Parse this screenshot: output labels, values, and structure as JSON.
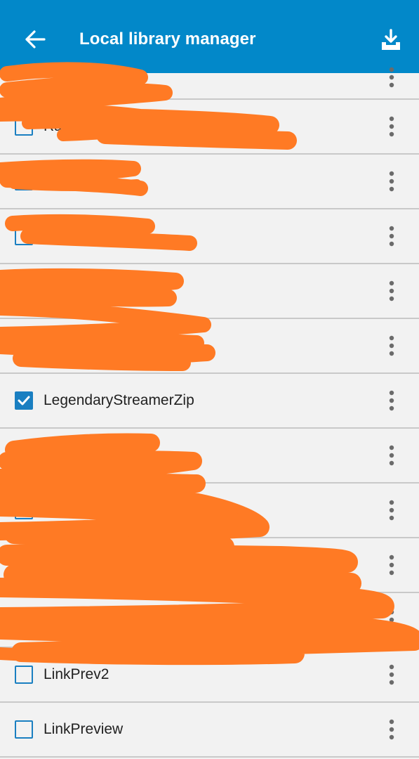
{
  "toolbar": {
    "title": "Local library manager",
    "back_icon": "arrow-back-icon",
    "download_icon": "download-tray-icon",
    "background_color": "#0288c9"
  },
  "list": {
    "items": [
      {
        "label": "",
        "checked": false,
        "redacted": true
      },
      {
        "label": "Ra",
        "checked": false,
        "redacted": true
      },
      {
        "label": "",
        "checked": false,
        "redacted": true
      },
      {
        "label": "",
        "checked": false,
        "redacted": true
      },
      {
        "label": "",
        "checked": false,
        "redacted": true
      },
      {
        "label": "",
        "checked": false,
        "redacted": true
      },
      {
        "label": "LegendaryStreamerZip",
        "checked": true,
        "redacted": false
      },
      {
        "label": "",
        "checked": false,
        "redacted": true
      },
      {
        "label": "",
        "checked": false,
        "redacted": true
      },
      {
        "label": "",
        "checked": false,
        "redacted": true
      },
      {
        "label": "",
        "checked": false,
        "redacted": true
      },
      {
        "label": "LinkPrev2",
        "checked": false,
        "redacted": false
      },
      {
        "label": "LinkPreview",
        "checked": false,
        "redacted": false
      }
    ],
    "more_icon": "more-vertical-icon",
    "checkbox_color": "#1a7fc1"
  },
  "redaction": {
    "color": "#ff7a24"
  }
}
